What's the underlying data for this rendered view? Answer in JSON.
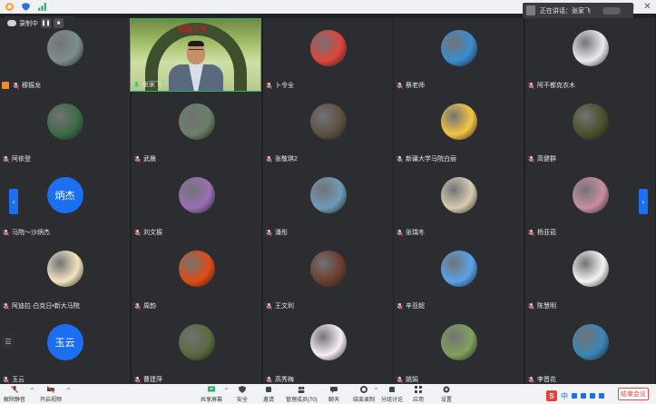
{
  "titlebar": {
    "icons": [
      "app-icon",
      "shield-icon",
      "signal-icon"
    ],
    "controls": [
      "minimize-icon",
      "maximize-icon",
      "close-icon"
    ]
  },
  "recording": {
    "label": "录制中"
  },
  "speaking": {
    "label": "正在讲话：张家飞"
  },
  "host_video": {
    "name": "张家飞",
    "banner": "新疆大學"
  },
  "participants": [
    {
      "name": "穆振龙",
      "avatar": "landscape",
      "color": "#7d8f8a",
      "host": true
    },
    {
      "name": "卜令全",
      "avatar": "red-dragon",
      "color": "#e0443a"
    },
    {
      "name": "蔡老师",
      "avatar": "mountains",
      "color": "#3a8bd0"
    },
    {
      "name": "阿不都克衣木",
      "avatar": "person",
      "color": "#e9ecef"
    },
    {
      "name": "阿依登",
      "avatar": "tunnel",
      "color": "#3c6b47"
    },
    {
      "name": "武晨",
      "avatar": "sky-hill",
      "color": "#6b7f67"
    },
    {
      "name": "张敬琪2",
      "avatar": "photo-person",
      "color": "#5c5140"
    },
    {
      "name": "新疆大学马院白丽",
      "avatar": "pikachu",
      "color": "#f5c542"
    },
    {
      "name": "高健群",
      "avatar": "bee",
      "color": "#4a4f2a"
    },
    {
      "name": "马院～沙炳杰",
      "avatar": "text",
      "avatar_text": "炳杰",
      "color": "#1b6ff0"
    },
    {
      "name": "刘文振",
      "avatar": "flowers",
      "color": "#9b6fb3"
    },
    {
      "name": "潘彤",
      "avatar": "sea",
      "color": "#6f9ab8"
    },
    {
      "name": "张瑞冬",
      "avatar": "reader",
      "color": "#d9cbb3"
    },
    {
      "name": "杨亚茹",
      "avatar": "beach",
      "color": "#c98ea0"
    },
    {
      "name": "阿迪拉·白克日•新大马院",
      "avatar": "cartoon-girl",
      "color": "#f4e3c0"
    },
    {
      "name": "周韵",
      "avatar": "sunset",
      "color": "#e24b14"
    },
    {
      "name": "王文利",
      "avatar": "tea",
      "color": "#6b3d2e"
    },
    {
      "name": "辛亚超",
      "avatar": "shinchan",
      "color": "#5aa2e8"
    },
    {
      "name": "陈慧明",
      "avatar": "pig",
      "color": "#f4f4f4"
    },
    {
      "name": "玉云",
      "avatar": "text",
      "avatar_text": "玉云",
      "color": "#1b6ff0"
    },
    {
      "name": "曹建萍",
      "avatar": "soldiers",
      "color": "#5b6a3e"
    },
    {
      "name": "高秀梅",
      "avatar": "cute-girl",
      "color": "#f7eef3"
    },
    {
      "name": "姚娟",
      "avatar": "field",
      "color": "#7fa25a"
    },
    {
      "name": "李晋花",
      "avatar": "lake",
      "color": "#3b86b5"
    }
  ],
  "toolbar": {
    "items": [
      {
        "key": "mute",
        "label": "解除静音",
        "icon": "mic-off-icon"
      },
      {
        "key": "video",
        "label": "开启视频",
        "icon": "video-off-icon"
      },
      {
        "key": "share",
        "label": "共享屏幕",
        "icon": "share-screen-icon"
      },
      {
        "key": "security",
        "label": "安全",
        "icon": "shield-icon"
      },
      {
        "key": "invite",
        "label": "邀请",
        "icon": "invite-icon"
      },
      {
        "key": "members",
        "label": "管理成员(70)",
        "icon": "members-icon"
      },
      {
        "key": "chat",
        "label": "聊天",
        "icon": "chat-icon"
      },
      {
        "key": "stop_rec",
        "label": "结束录制",
        "icon": "record-icon"
      },
      {
        "key": "breakout",
        "label": "分组讨论",
        "icon": "breakout-icon"
      },
      {
        "key": "apps",
        "label": "应用",
        "icon": "apps-icon"
      },
      {
        "key": "settings",
        "label": "设置",
        "icon": "gear-icon"
      }
    ],
    "end_label": "结束会议"
  },
  "ime": {
    "logo": "S",
    "lang": "中"
  }
}
